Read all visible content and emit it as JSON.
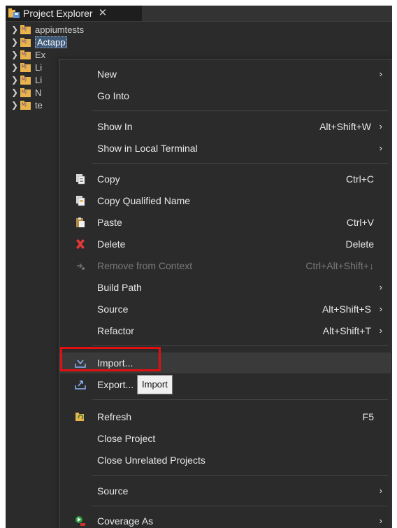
{
  "tab": {
    "title": "Project Explorer",
    "close": "✕"
  },
  "tree": [
    {
      "label": "appiumtests",
      "selected": false
    },
    {
      "label": "Actapp",
      "selected": true
    },
    {
      "label": "Ex",
      "selected": false
    },
    {
      "label": "Li",
      "selected": false
    },
    {
      "label": "Li",
      "selected": false
    },
    {
      "label": "N",
      "selected": false
    },
    {
      "label": "te",
      "selected": false
    }
  ],
  "menu": {
    "items": [
      {
        "label": "New",
        "shortcut": "",
        "arrow": "›"
      },
      {
        "label": "Go Into",
        "shortcut": "",
        "arrow": ""
      },
      {
        "label": "Show In",
        "shortcut": "Alt+Shift+W",
        "arrow": "›"
      },
      {
        "label": "Show in Local Terminal",
        "shortcut": "",
        "arrow": "›"
      },
      {
        "label": "Copy",
        "shortcut": "Ctrl+C",
        "arrow": ""
      },
      {
        "label": "Copy Qualified Name",
        "shortcut": "",
        "arrow": ""
      },
      {
        "label": "Paste",
        "shortcut": "Ctrl+V",
        "arrow": ""
      },
      {
        "label": "Delete",
        "shortcut": "Delete",
        "arrow": ""
      },
      {
        "label": "Remove from Context",
        "shortcut": "Ctrl+Alt+Shift+↓",
        "arrow": ""
      },
      {
        "label": "Build Path",
        "shortcut": "",
        "arrow": "›"
      },
      {
        "label": "Source",
        "shortcut": "Alt+Shift+S",
        "arrow": "›"
      },
      {
        "label": "Refactor",
        "shortcut": "Alt+Shift+T",
        "arrow": "›"
      },
      {
        "label": "Import...",
        "shortcut": "",
        "arrow": ""
      },
      {
        "label": "Export...",
        "shortcut": "",
        "arrow": ""
      },
      {
        "label": "Refresh",
        "shortcut": "F5",
        "arrow": ""
      },
      {
        "label": "Close Project",
        "shortcut": "",
        "arrow": ""
      },
      {
        "label": "Close Unrelated Projects",
        "shortcut": "",
        "arrow": ""
      },
      {
        "label": "Source",
        "shortcut": "",
        "arrow": "›"
      },
      {
        "label": "Coverage As",
        "shortcut": "",
        "arrow": "›"
      }
    ]
  },
  "tooltip": {
    "text": "Import"
  },
  "colors": {
    "highlight": "#e01010",
    "background": "#2b2b2b"
  }
}
